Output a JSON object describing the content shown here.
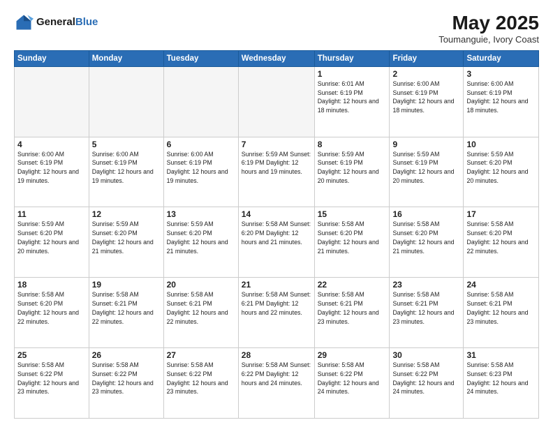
{
  "header": {
    "logo_line1": "General",
    "logo_line2": "Blue",
    "month_title": "May 2025",
    "location": "Toumanguie, Ivory Coast"
  },
  "weekdays": [
    "Sunday",
    "Monday",
    "Tuesday",
    "Wednesday",
    "Thursday",
    "Friday",
    "Saturday"
  ],
  "weeks": [
    [
      {
        "day": "",
        "info": ""
      },
      {
        "day": "",
        "info": ""
      },
      {
        "day": "",
        "info": ""
      },
      {
        "day": "",
        "info": ""
      },
      {
        "day": "1",
        "info": "Sunrise: 6:01 AM\nSunset: 6:19 PM\nDaylight: 12 hours\nand 18 minutes."
      },
      {
        "day": "2",
        "info": "Sunrise: 6:00 AM\nSunset: 6:19 PM\nDaylight: 12 hours\nand 18 minutes."
      },
      {
        "day": "3",
        "info": "Sunrise: 6:00 AM\nSunset: 6:19 PM\nDaylight: 12 hours\nand 18 minutes."
      }
    ],
    [
      {
        "day": "4",
        "info": "Sunrise: 6:00 AM\nSunset: 6:19 PM\nDaylight: 12 hours\nand 19 minutes."
      },
      {
        "day": "5",
        "info": "Sunrise: 6:00 AM\nSunset: 6:19 PM\nDaylight: 12 hours\nand 19 minutes."
      },
      {
        "day": "6",
        "info": "Sunrise: 6:00 AM\nSunset: 6:19 PM\nDaylight: 12 hours\nand 19 minutes."
      },
      {
        "day": "7",
        "info": "Sunrise: 5:59 AM\nSunset: 6:19 PM\nDaylight: 12 hours\nand 19 minutes."
      },
      {
        "day": "8",
        "info": "Sunrise: 5:59 AM\nSunset: 6:19 PM\nDaylight: 12 hours\nand 20 minutes."
      },
      {
        "day": "9",
        "info": "Sunrise: 5:59 AM\nSunset: 6:19 PM\nDaylight: 12 hours\nand 20 minutes."
      },
      {
        "day": "10",
        "info": "Sunrise: 5:59 AM\nSunset: 6:20 PM\nDaylight: 12 hours\nand 20 minutes."
      }
    ],
    [
      {
        "day": "11",
        "info": "Sunrise: 5:59 AM\nSunset: 6:20 PM\nDaylight: 12 hours\nand 20 minutes."
      },
      {
        "day": "12",
        "info": "Sunrise: 5:59 AM\nSunset: 6:20 PM\nDaylight: 12 hours\nand 21 minutes."
      },
      {
        "day": "13",
        "info": "Sunrise: 5:59 AM\nSunset: 6:20 PM\nDaylight: 12 hours\nand 21 minutes."
      },
      {
        "day": "14",
        "info": "Sunrise: 5:58 AM\nSunset: 6:20 PM\nDaylight: 12 hours\nand 21 minutes."
      },
      {
        "day": "15",
        "info": "Sunrise: 5:58 AM\nSunset: 6:20 PM\nDaylight: 12 hours\nand 21 minutes."
      },
      {
        "day": "16",
        "info": "Sunrise: 5:58 AM\nSunset: 6:20 PM\nDaylight: 12 hours\nand 21 minutes."
      },
      {
        "day": "17",
        "info": "Sunrise: 5:58 AM\nSunset: 6:20 PM\nDaylight: 12 hours\nand 22 minutes."
      }
    ],
    [
      {
        "day": "18",
        "info": "Sunrise: 5:58 AM\nSunset: 6:20 PM\nDaylight: 12 hours\nand 22 minutes."
      },
      {
        "day": "19",
        "info": "Sunrise: 5:58 AM\nSunset: 6:21 PM\nDaylight: 12 hours\nand 22 minutes."
      },
      {
        "day": "20",
        "info": "Sunrise: 5:58 AM\nSunset: 6:21 PM\nDaylight: 12 hours\nand 22 minutes."
      },
      {
        "day": "21",
        "info": "Sunrise: 5:58 AM\nSunset: 6:21 PM\nDaylight: 12 hours\nand 22 minutes."
      },
      {
        "day": "22",
        "info": "Sunrise: 5:58 AM\nSunset: 6:21 PM\nDaylight: 12 hours\nand 23 minutes."
      },
      {
        "day": "23",
        "info": "Sunrise: 5:58 AM\nSunset: 6:21 PM\nDaylight: 12 hours\nand 23 minutes."
      },
      {
        "day": "24",
        "info": "Sunrise: 5:58 AM\nSunset: 6:21 PM\nDaylight: 12 hours\nand 23 minutes."
      }
    ],
    [
      {
        "day": "25",
        "info": "Sunrise: 5:58 AM\nSunset: 6:22 PM\nDaylight: 12 hours\nand 23 minutes."
      },
      {
        "day": "26",
        "info": "Sunrise: 5:58 AM\nSunset: 6:22 PM\nDaylight: 12 hours\nand 23 minutes."
      },
      {
        "day": "27",
        "info": "Sunrise: 5:58 AM\nSunset: 6:22 PM\nDaylight: 12 hours\nand 23 minutes."
      },
      {
        "day": "28",
        "info": "Sunrise: 5:58 AM\nSunset: 6:22 PM\nDaylight: 12 hours\nand 24 minutes."
      },
      {
        "day": "29",
        "info": "Sunrise: 5:58 AM\nSunset: 6:22 PM\nDaylight: 12 hours\nand 24 minutes."
      },
      {
        "day": "30",
        "info": "Sunrise: 5:58 AM\nSunset: 6:22 PM\nDaylight: 12 hours\nand 24 minutes."
      },
      {
        "day": "31",
        "info": "Sunrise: 5:58 AM\nSunset: 6:23 PM\nDaylight: 12 hours\nand 24 minutes."
      }
    ]
  ]
}
